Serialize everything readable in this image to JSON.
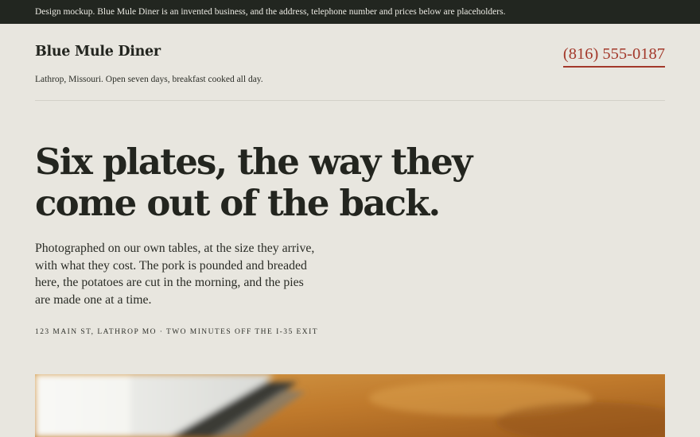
{
  "notice": {
    "text": "Design mockup. Blue Mule Diner is an invented business, and the address, telephone number and prices below are placeholders."
  },
  "header": {
    "brand": "Blue Mule Diner",
    "tagline": "Lathrop, Missouri. Open seven days, breakfast cooked all day.",
    "phone": "(816) 555-0187"
  },
  "hero": {
    "headline": "Six plates, the way they come out of the back.",
    "intro": "Photographed on our own tables, at the size they arrive, with what they cost. The pork is pounded and breaded here, the potatoes are cut in the morning, and the pies are made one at a time.",
    "address": "123 MAIN ST, LATHROP MO · TWO MINUTES OFF THE I-35 EXIT"
  },
  "colors": {
    "background": "#e8e6df",
    "notice_bar": "#222620",
    "ink": "#23251f",
    "accent": "#a3392b"
  }
}
